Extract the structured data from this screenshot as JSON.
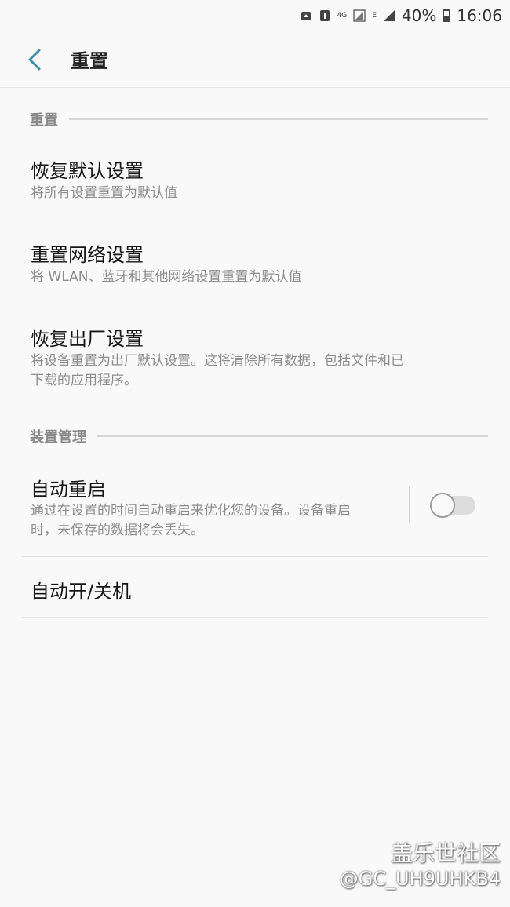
{
  "status_bar": {
    "network_4g": "4G",
    "network_e": "E",
    "battery_percent": "40%",
    "time": "16:06",
    "icons": [
      "recycle-icon",
      "sim-1-icon",
      "signal-icon",
      "battery-icon"
    ]
  },
  "app_bar": {
    "title": "重置",
    "back_icon": "chevron-left-icon"
  },
  "sections": {
    "reset": {
      "label": "重置",
      "items": [
        {
          "title": "恢复默认设置",
          "subtitle": "将所有设置重置为默认值"
        },
        {
          "title": "重置网络设置",
          "subtitle": "将 WLAN、蓝牙和其他网络设置重置为默认值"
        },
        {
          "title": "恢复出厂设置",
          "subtitle_line1": "将设备重置为出厂默认设置。这将清除所有数据，包括文件和已",
          "subtitle_line2": "下载的应用程序。"
        }
      ]
    },
    "device_management": {
      "label": "装置管理",
      "items": [
        {
          "title": "自动重启",
          "subtitle_line1": "通过在设置的时间自动重启来优化您的设备。设备重启",
          "subtitle_line2": "时，未保存的数据将会丢失。",
          "toggle_on": false
        },
        {
          "title": "自动开/关机"
        }
      ]
    }
  },
  "watermark": {
    "logo": "盖乐世社区",
    "handle": "@GC_UH9UHKB4"
  },
  "colors": {
    "accent": "#3b8fa8",
    "background": "#f9f9f9"
  }
}
